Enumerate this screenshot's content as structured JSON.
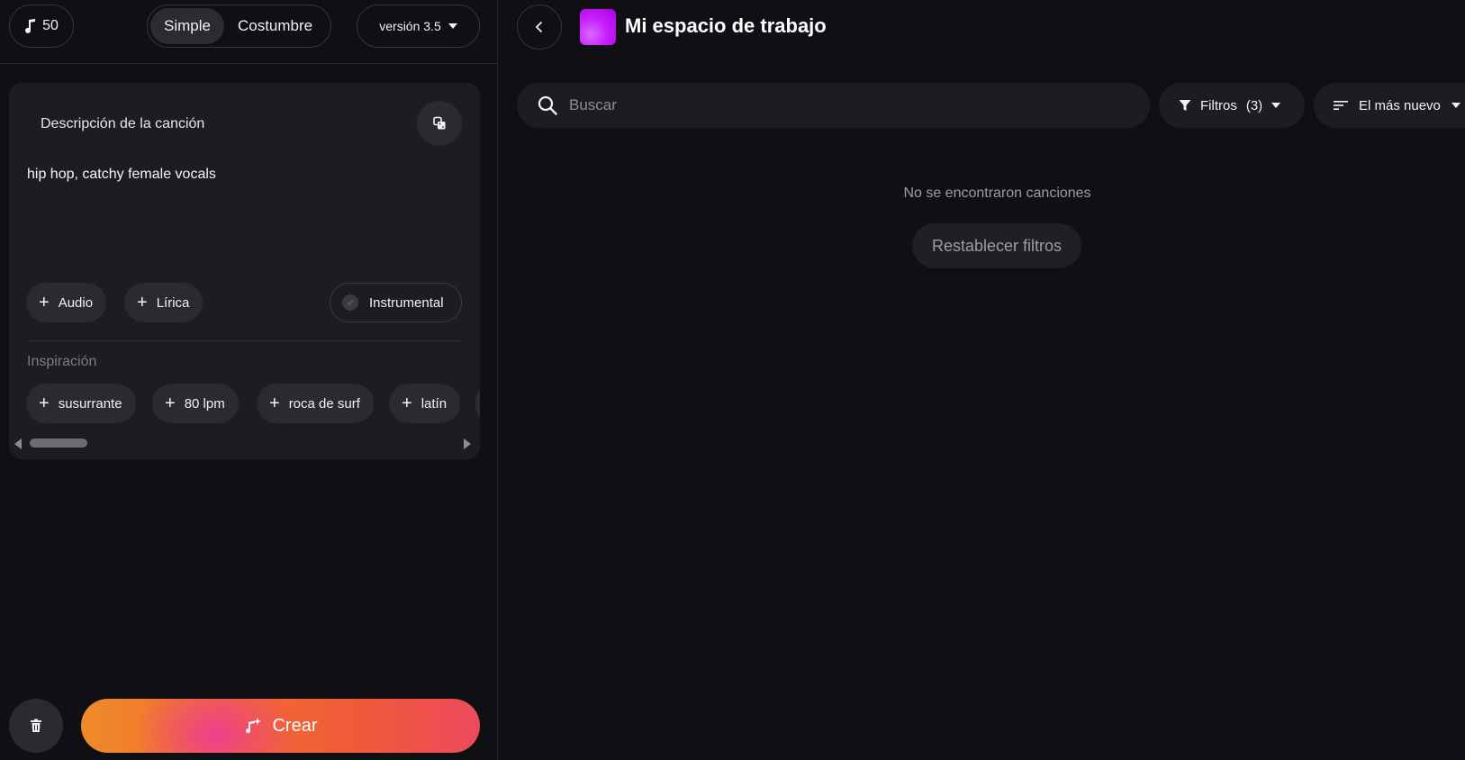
{
  "header": {
    "credits": "50",
    "modes": [
      {
        "label": "Simple",
        "active": true
      },
      {
        "label": "Costumbre",
        "active": false
      }
    ],
    "version": "versión 3.5"
  },
  "form": {
    "description_label": "Descripción de la canción",
    "description_value": "hip hop, catchy female vocals",
    "add_chips": [
      "Audio",
      "Lírica"
    ],
    "instrumental_label": "Instrumental",
    "inspiration_label": "Inspiración",
    "inspiration_chips": [
      "susurrante",
      "80 lpm",
      "roca de surf",
      "latín"
    ],
    "create_label": "Crear"
  },
  "workspace": {
    "title": "Mi espacio de trabajo",
    "search_placeholder": "Buscar",
    "filters_label": "Filtros",
    "filters_count": "(3)",
    "sort_label": "El más nuevo",
    "empty_message": "No se encontraron canciones",
    "reset_label": "Restablecer filtros"
  },
  "icons": {
    "credits": "music-note-icon",
    "shuffle": "dice-icon",
    "back": "chevron-left-icon",
    "search": "search-icon",
    "filter": "funnel-icon",
    "sort": "sort-lines-icon",
    "trash": "trash-icon",
    "create": "sparkle-music-icon"
  },
  "colors": {
    "background": "#101014",
    "card": "#1c1c21",
    "chip": "#2a2a30",
    "accent_orange": "#f26a2e",
    "accent_pink": "#ee3f8c",
    "workspace_thumb": "#c91fff"
  }
}
